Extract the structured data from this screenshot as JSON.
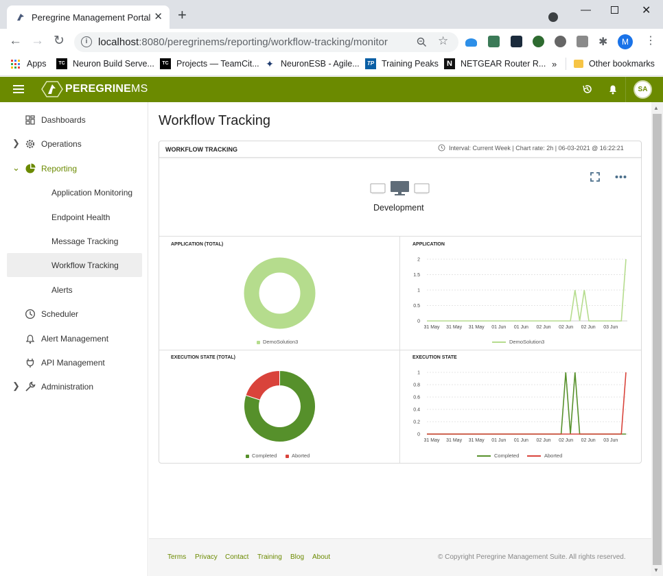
{
  "browser": {
    "tab_title": "Peregrine Management Portal",
    "url_host": "localhost",
    "url_rest": ":8080/peregrinems/reporting/workflow-tracking/monitor",
    "profile_initial": "M",
    "bookmarks": [
      {
        "label": "Apps"
      },
      {
        "label": "Neuron Build Serve..."
      },
      {
        "label": "Projects — TeamCit..."
      },
      {
        "label": "NeuronESB - Agile..."
      },
      {
        "label": "Training Peaks"
      },
      {
        "label": "NETGEAR Router R..."
      }
    ],
    "bookmarks_overflow": "»",
    "other_bookmarks": "Other bookmarks"
  },
  "app": {
    "brand_bold": "PEREGRINE",
    "brand_light": "MS",
    "avatar_initials": "SA"
  },
  "sidebar": {
    "items": [
      {
        "label": "Dashboards"
      },
      {
        "label": "Operations"
      },
      {
        "label": "Reporting"
      },
      {
        "label": "Application Monitoring"
      },
      {
        "label": "Endpoint Health"
      },
      {
        "label": "Message Tracking"
      },
      {
        "label": "Workflow Tracking"
      },
      {
        "label": "Alerts"
      },
      {
        "label": "Scheduler"
      },
      {
        "label": "Alert Management"
      },
      {
        "label": "API Management"
      },
      {
        "label": "Administration"
      }
    ]
  },
  "page": {
    "title": "Workflow Tracking",
    "panel_title": "WORKFLOW TRACKING",
    "panel_meta": "Interval: Current Week  |  Chart rate: 2h | 06-03-2021 @ 16:22:21",
    "environment": "Development"
  },
  "colors": {
    "accent": "#6b8a00",
    "light_green": "#b5dc8d",
    "completed": "#56902b",
    "aborted": "#d9433b"
  },
  "chart_data": [
    {
      "type": "pie",
      "title": "APPLICATION (TOTAL)",
      "categories": [
        "DemoSolution3"
      ],
      "values": [
        1
      ],
      "legend": [
        "DemoSolution3"
      ]
    },
    {
      "type": "line",
      "title": "APPLICATION",
      "x": [
        "31 May",
        "31 May",
        "31 May",
        "01 Jun",
        "01 Jun",
        "02 Jun",
        "02 Jun",
        "02 Jun",
        "03 Jun"
      ],
      "ylim": [
        0,
        2
      ],
      "yticks": [
        "2",
        "1.5",
        "1",
        "0.5",
        "0"
      ],
      "series": [
        {
          "name": "DemoSolution3",
          "values": [
            0,
            0,
            0,
            0,
            0,
            0,
            0,
            0,
            0,
            0,
            0,
            0,
            0,
            0,
            0,
            0,
            0,
            0,
            0,
            0,
            0,
            0,
            0,
            0,
            0,
            0,
            0,
            0,
            0,
            0,
            0,
            0,
            1,
            0,
            1,
            0,
            0,
            0,
            0,
            0,
            0,
            0,
            0,
            2
          ]
        }
      ]
    },
    {
      "type": "pie",
      "title": "EXECUTION STATE (TOTAL)",
      "categories": [
        "Completed",
        "Aborted"
      ],
      "values": [
        4,
        1
      ],
      "legend": [
        "Completed",
        "Aborted"
      ]
    },
    {
      "type": "line",
      "title": "EXECUTION STATE",
      "x": [
        "31 May",
        "31 May",
        "31 May",
        "01 Jun",
        "01 Jun",
        "02 Jun",
        "02 Jun",
        "02 Jun",
        "03 Jun"
      ],
      "ylim": [
        0,
        1
      ],
      "yticks": [
        "1",
        "0.8",
        "0.6",
        "0.4",
        "0.2",
        "0"
      ],
      "series": [
        {
          "name": "Completed",
          "values": [
            0,
            0,
            0,
            0,
            0,
            0,
            0,
            0,
            0,
            0,
            0,
            0,
            0,
            0,
            0,
            0,
            0,
            0,
            0,
            0,
            0,
            0,
            0,
            0,
            0,
            0,
            0,
            0,
            0,
            0,
            1,
            0,
            1,
            0,
            0,
            0,
            0,
            0,
            0,
            0,
            0,
            0,
            0,
            0
          ]
        },
        {
          "name": "Aborted",
          "values": [
            0,
            0,
            0,
            0,
            0,
            0,
            0,
            0,
            0,
            0,
            0,
            0,
            0,
            0,
            0,
            0,
            0,
            0,
            0,
            0,
            0,
            0,
            0,
            0,
            0,
            0,
            0,
            0,
            0,
            0,
            0,
            0,
            0,
            0,
            0,
            0,
            0,
            0,
            0,
            0,
            0,
            0,
            0,
            1
          ]
        }
      ]
    }
  ],
  "footer": {
    "links": [
      "Terms",
      "Privacy",
      "Contact",
      "Training",
      "Blog",
      "About"
    ],
    "copyright": "© Copyright Peregrine Management Suite. All rights reserved."
  }
}
